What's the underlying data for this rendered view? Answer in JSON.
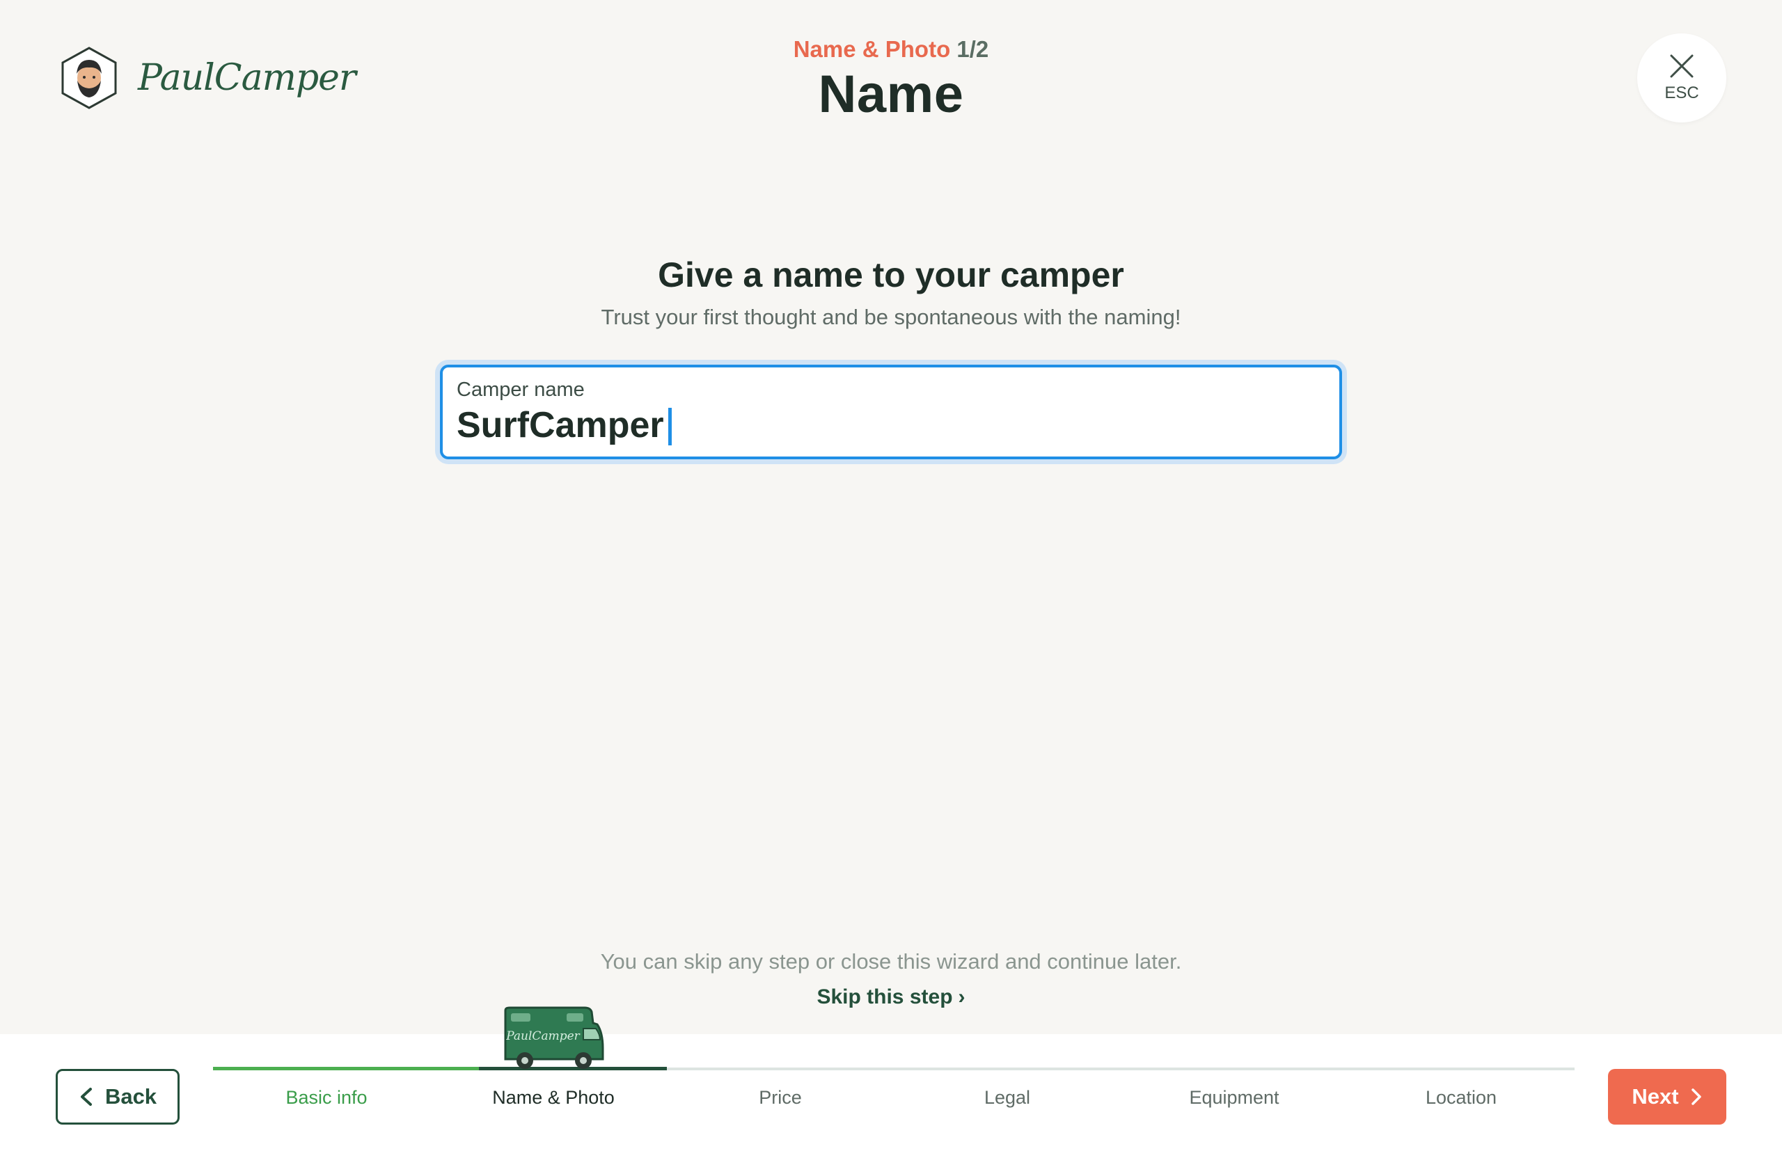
{
  "header": {
    "logo_text": "PaulCamper",
    "step_name": "Name & Photo",
    "step_count": "1/2",
    "title": "Name",
    "close_label": "ESC"
  },
  "main": {
    "heading": "Give a name to your camper",
    "subheading": "Trust your first thought and be spontaneous with the naming!",
    "field": {
      "label": "Camper name",
      "value": "SurfCamper"
    }
  },
  "skip": {
    "note": "You can skip any step or close this wizard and continue later.",
    "link": "Skip this step"
  },
  "footer": {
    "back_label": "Back",
    "next_label": "Next",
    "van_logo_text": "PaulCamper",
    "steps": [
      {
        "label": "Basic info",
        "state": "done"
      },
      {
        "label": "Name & Photo",
        "state": "current"
      },
      {
        "label": "Price",
        "state": "upcoming"
      },
      {
        "label": "Legal",
        "state": "upcoming"
      },
      {
        "label": "Equipment",
        "state": "upcoming"
      },
      {
        "label": "Location",
        "state": "upcoming"
      }
    ]
  },
  "colors": {
    "accent": "#ef6a4f",
    "brand_green": "#24503b",
    "progress_green": "#4caf50",
    "focus_blue": "#1f8fe6",
    "background": "#f7f6f3"
  }
}
